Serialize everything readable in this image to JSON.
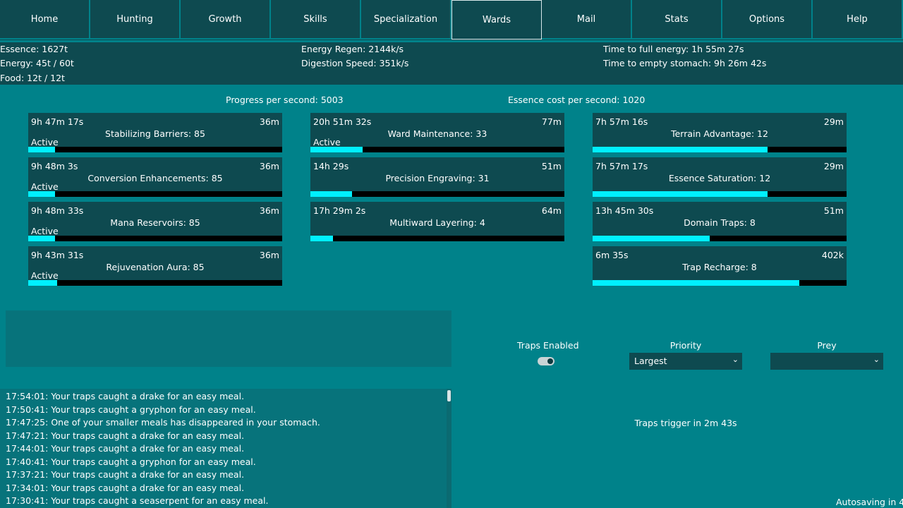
{
  "nav": {
    "tabs": [
      "Home",
      "Hunting",
      "Growth",
      "Skills",
      "Specialization",
      "Wards",
      "Mail",
      "Stats",
      "Options",
      "Help"
    ],
    "selected": "Wards"
  },
  "stats": {
    "essence": "Essence: 1627t",
    "energy": "Energy: 45t / 60t",
    "food": "Food: 12t / 12t",
    "energy_regen": "Energy Regen: 2144k/s",
    "digestion": "Digestion Speed: 351k/s",
    "full_energy": "Time to full energy: 1h 55m 27s",
    "empty_stomach": "Time to empty stomach: 9h 26m 42s"
  },
  "wards_header": {
    "progress": "Progress per second: 5003",
    "essence_cost": "Essence cost per second: 1020"
  },
  "wards": {
    "col1": [
      {
        "time": "9h 47m 17s",
        "cost": "36m",
        "name": "Stabilizing Barriers: 85",
        "status": "Active",
        "progress": 0.105
      },
      {
        "time": "9h 48m 3s",
        "cost": "36m",
        "name": "Conversion Enhancements: 85",
        "status": "Active",
        "progress": 0.105
      },
      {
        "time": "9h 48m 33s",
        "cost": "36m",
        "name": "Mana Reservoirs: 85",
        "status": "Active",
        "progress": 0.105
      },
      {
        "time": "9h 43m 31s",
        "cost": "36m",
        "name": "Rejuvenation Aura: 85",
        "status": "Active",
        "progress": 0.115
      }
    ],
    "col2": [
      {
        "time": "20h 51m 32s",
        "cost": "77m",
        "name": "Ward Maintenance: 33",
        "status": "Active",
        "progress": 0.205
      },
      {
        "time": "14h 29s",
        "cost": "51m",
        "name": "Precision Engraving: 31",
        "status": "",
        "progress": 0.165
      },
      {
        "time": "17h 29m 2s",
        "cost": "64m",
        "name": "Multiward Layering: 4",
        "status": "",
        "progress": 0.09
      }
    ],
    "col3": [
      {
        "time": "7h 57m 16s",
        "cost": "29m",
        "name": "Terrain Advantage: 12",
        "status": "",
        "progress": 0.69
      },
      {
        "time": "7h 57m 17s",
        "cost": "29m",
        "name": "Essence Saturation: 12",
        "status": "",
        "progress": 0.69
      },
      {
        "time": "13h 45m 30s",
        "cost": "51m",
        "name": "Domain Traps: 8",
        "status": "",
        "progress": 0.46
      },
      {
        "time": "6m 35s",
        "cost": "402k",
        "name": "Trap Recharge: 8",
        "status": "",
        "progress": 0.815
      }
    ]
  },
  "traps": {
    "enabled_label": "Traps Enabled",
    "enabled": true,
    "priority_label": "Priority",
    "priority_value": "Largest",
    "prey_label": "Prey",
    "prey_value": "",
    "trigger_text": "Traps trigger in 2m 43s"
  },
  "log": [
    "17:54:01: Your traps caught a drake for an easy meal.",
    "17:50:41: Your traps caught a gryphon for an easy meal.",
    "17:47:25: One of your smaller meals has disappeared in your stomach.",
    "17:47:21: Your traps caught a drake for an easy meal.",
    "17:44:01: Your traps caught a drake for an easy meal.",
    "17:40:41: Your traps caught a gryphon for an easy meal.",
    "17:37:21: Your traps caught a drake for an easy meal.",
    "17:34:01: Your traps caught a drake for an easy meal.",
    "17:30:41: Your traps caught a seaserpent for an easy meal."
  ],
  "autosave": "Autosaving in 4",
  "icons": {
    "dropdown": "chevron-down-icon",
    "toggle": "toggle-switch"
  }
}
